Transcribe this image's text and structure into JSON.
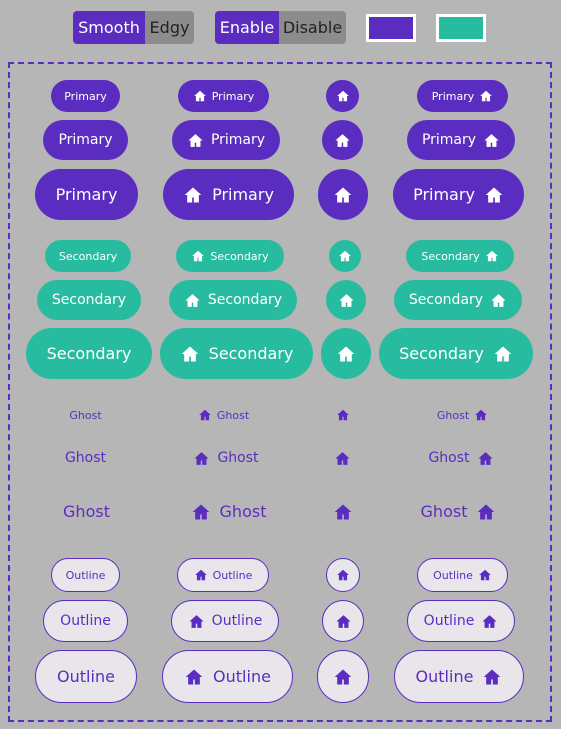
{
  "toggles": {
    "shape": {
      "on_label": "Smooth",
      "off_label": "Edgy"
    },
    "state": {
      "on_label": "Enable",
      "off_label": "Disable"
    }
  },
  "swatches": {
    "primary_color": "#5a2dc0",
    "secondary_color": "#27bca0"
  },
  "buttons": {
    "primary": "Primary",
    "secondary": "Secondary",
    "ghost": "Ghost",
    "outline": "Outline"
  },
  "icons": {
    "button_icon": "home-icon"
  },
  "colors": {
    "accent": "#5a2dc0",
    "secondary": "#27bca0",
    "background": "#b6b6b6",
    "outline_fill": "#e8e6ea"
  }
}
